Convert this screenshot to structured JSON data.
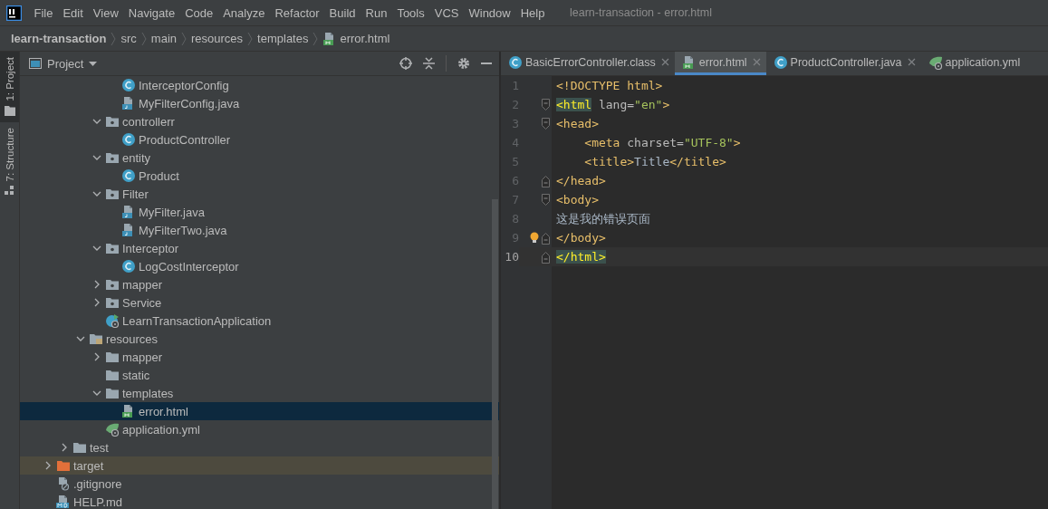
{
  "window": {
    "title": "learn-transaction - error.html"
  },
  "menu": [
    "File",
    "Edit",
    "View",
    "Navigate",
    "Code",
    "Analyze",
    "Refactor",
    "Build",
    "Run",
    "Tools",
    "VCS",
    "Window",
    "Help"
  ],
  "breadcrumb": [
    {
      "label": "learn-transaction",
      "kind": "project"
    },
    {
      "label": "src",
      "kind": "folder"
    },
    {
      "label": "main",
      "kind": "folder"
    },
    {
      "label": "resources",
      "kind": "folder"
    },
    {
      "label": "templates",
      "kind": "folder"
    },
    {
      "label": "error.html",
      "kind": "html"
    }
  ],
  "tool_stripe": [
    {
      "label": "1: Project",
      "kind": "folder",
      "selected": true
    },
    {
      "label": "7: Structure",
      "kind": "structure",
      "selected": false
    }
  ],
  "project_panel": {
    "title": "Project",
    "tree": [
      {
        "children": [
          {
            "children": [
              {
                "children": [
                  {
                    "children": [
                      {
                        "children": [
                          {
                            "label": "InterceptorConfig",
                            "kind": "class",
                            "selected": false
                          },
                          {
                            "label": "MyFilterConfig.java",
                            "kind": "java",
                            "selected": false
                          }
                        ]
                      },
                      {
                        "label": "controllerr",
                        "kind": "package",
                        "expanded": true,
                        "selected": false,
                        "children": [
                          {
                            "label": "ProductController",
                            "kind": "class",
                            "selected": false
                          }
                        ]
                      },
                      {
                        "label": "entity",
                        "kind": "package",
                        "expanded": true,
                        "selected": false,
                        "children": [
                          {
                            "label": "Product",
                            "kind": "class",
                            "selected": false
                          }
                        ]
                      },
                      {
                        "label": "Filter",
                        "kind": "package",
                        "expanded": true,
                        "selected": false,
                        "children": [
                          {
                            "label": "MyFilter.java",
                            "kind": "java",
                            "selected": false
                          },
                          {
                            "label": "MyFilterTwo.java",
                            "kind": "java",
                            "selected": false
                          }
                        ]
                      },
                      {
                        "label": "Interceptor",
                        "kind": "package",
                        "expanded": true,
                        "selected": false,
                        "children": [
                          {
                            "label": "LogCostInterceptor",
                            "kind": "class",
                            "selected": false
                          }
                        ]
                      },
                      {
                        "label": "mapper",
                        "kind": "package",
                        "expanded": false,
                        "selected": false
                      },
                      {
                        "label": "Service",
                        "kind": "package",
                        "expanded": false,
                        "selected": false
                      },
                      {
                        "label": "LearnTransactionApplication",
                        "kind": "app",
                        "selected": false
                      }
                    ]
                  },
                  {
                    "label": "resources",
                    "kind": "resources",
                    "expanded": true,
                    "selected": false,
                    "children": [
                      {
                        "label": "mapper",
                        "kind": "folder",
                        "expanded": false,
                        "selected": false
                      },
                      {
                        "label": "static",
                        "kind": "folder",
                        "selected": false
                      },
                      {
                        "label": "templates",
                        "kind": "folder",
                        "expanded": true,
                        "selected": false,
                        "children": [
                          {
                            "label": "error.html",
                            "kind": "html",
                            "selected": true
                          }
                        ]
                      },
                      {
                        "label": "application.yml",
                        "kind": "yml",
                        "selected": false
                      }
                    ]
                  }
                ]
              },
              {
                "label": "test",
                "kind": "folder",
                "expanded": false,
                "selected": false
              }
            ]
          },
          {
            "label": "target",
            "kind": "excluded",
            "expanded": false,
            "selected": false
          },
          {
            "label": ".gitignore",
            "kind": "ignore",
            "selected": false
          },
          {
            "label": "HELP.md",
            "kind": "md",
            "selected": false
          }
        ]
      }
    ]
  },
  "editor": {
    "tabs": [
      {
        "label": "BasicErrorController.class",
        "kind": "class",
        "selected": false,
        "closable": true
      },
      {
        "label": "error.html",
        "kind": "html",
        "selected": true,
        "closable": true
      },
      {
        "label": "ProductController.java",
        "kind": "class",
        "selected": false,
        "closable": true
      },
      {
        "label": "application.yml",
        "kind": "yml",
        "selected": false,
        "closable": false
      }
    ],
    "lines": [
      {
        "number": "1",
        "current": false,
        "fold_open": false,
        "fold_close": false,
        "tokens": [
          {
            "kind": "tag",
            "text": "<!DOCTYPE html>"
          }
        ]
      },
      {
        "number": "2",
        "current": false,
        "fold_open": true,
        "fold_close": false,
        "tokens": [
          {
            "kind": "tag",
            "text": "<html",
            "match": true
          },
          {
            "kind": "attr",
            "text": " lang="
          },
          {
            "kind": "value",
            "text": "\"en\""
          },
          {
            "kind": "tag",
            "text": ">"
          }
        ]
      },
      {
        "number": "3",
        "current": false,
        "fold_open": true,
        "fold_close": false,
        "tokens": [
          {
            "kind": "tag",
            "text": "<head>"
          }
        ]
      },
      {
        "number": "4",
        "current": false,
        "fold_open": false,
        "fold_close": false,
        "tokens": [
          {
            "kind": "tag",
            "text": "    <meta"
          },
          {
            "kind": "attr",
            "text": " charset="
          },
          {
            "kind": "value",
            "text": "\"UTF-8\""
          },
          {
            "kind": "tag",
            "text": ">"
          }
        ]
      },
      {
        "number": "5",
        "current": false,
        "fold_open": false,
        "fold_close": false,
        "tokens": [
          {
            "kind": "tag",
            "text": "    <title>"
          },
          {
            "kind": "text",
            "text": "Title"
          },
          {
            "kind": "tag",
            "text": "</title>"
          }
        ]
      },
      {
        "number": "6",
        "current": false,
        "fold_open": false,
        "fold_close": true,
        "tokens": [
          {
            "kind": "tag",
            "text": "</head>"
          }
        ]
      },
      {
        "number": "7",
        "current": false,
        "fold_open": true,
        "fold_close": false,
        "tokens": [
          {
            "kind": "tag",
            "text": "<body>"
          }
        ]
      },
      {
        "number": "8",
        "current": false,
        "fold_open": false,
        "fold_close": false,
        "tokens": [
          {
            "kind": "plain",
            "text": "这是我的错误页面"
          }
        ]
      },
      {
        "number": "9",
        "current": false,
        "fold_open": false,
        "fold_close": true,
        "bulb": true,
        "tokens": [
          {
            "kind": "tag",
            "text": "</body>"
          }
        ]
      },
      {
        "number": "10",
        "current": true,
        "fold_open": false,
        "fold_close": true,
        "tokens": [
          {
            "kind": "tag",
            "text": "</html>",
            "match": true
          }
        ]
      }
    ]
  }
}
